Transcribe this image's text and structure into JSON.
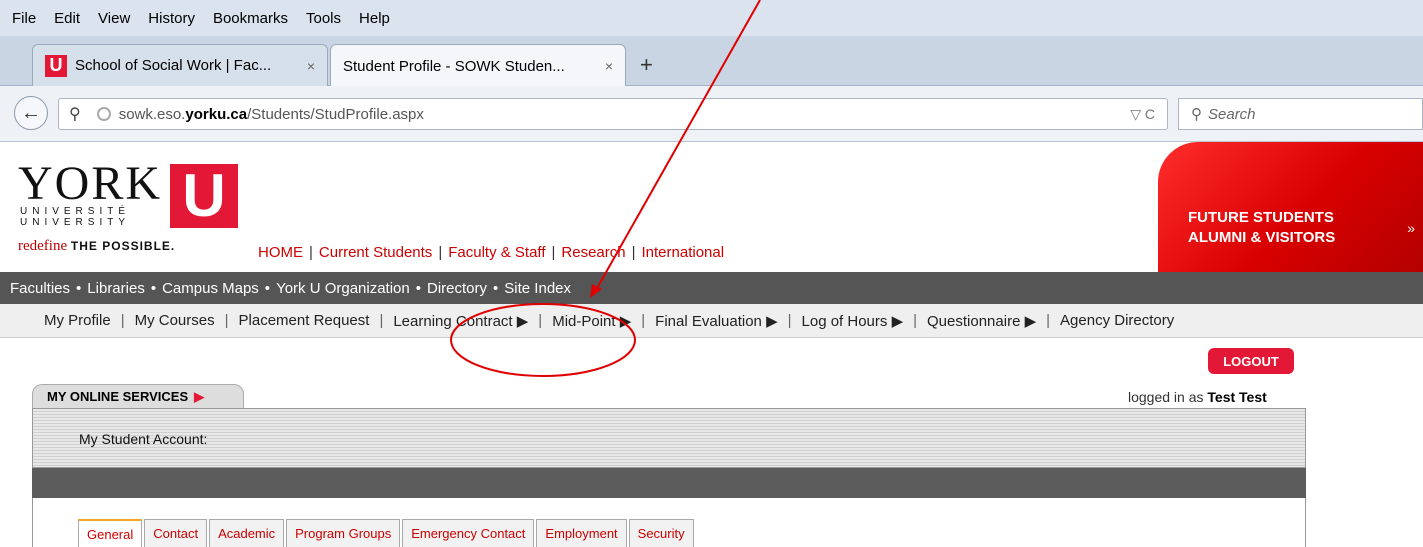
{
  "menubar": {
    "items": [
      "File",
      "Edit",
      "View",
      "History",
      "Bookmarks",
      "Tools",
      "Help"
    ],
    "access_keys": [
      "F",
      "E",
      "V",
      "s",
      "B",
      "T",
      "H"
    ]
  },
  "tabs": [
    {
      "label": "School of Social Work | Fac...",
      "close": "×"
    },
    {
      "label": "Student Profile - SOWK Studen...",
      "close": "×"
    }
  ],
  "newtab_label": "+",
  "url": {
    "prefix": "sowk.eso.",
    "domain": "yorku.ca",
    "path": "/Students/StudProfile.aspx",
    "right_icons": "▽ C"
  },
  "search": {
    "placeholder": "Search"
  },
  "header": {
    "logo_text": "YORK",
    "logo_u": "U",
    "logo_sub1": "UNIVERSITÉ",
    "logo_sub2": "UNIVERSITY",
    "tagline_script": "redefine",
    "tagline_bold": "THE POSSIBLE.",
    "links": [
      "HOME",
      "Current Students",
      "Faculty & Staff",
      "Research",
      "International"
    ],
    "future_line1": "FUTURE STUDENTS",
    "future_line2": "ALUMNI & VISITORS",
    "future_arrow": "»"
  },
  "darknav": [
    "Faculties",
    "Libraries",
    "Campus Maps",
    "York U Organization",
    "Directory",
    "Site Index"
  ],
  "subnav": [
    "My Profile",
    "My Courses",
    "Placement Request",
    "Learning Contract ▶",
    "Mid-Point ▶",
    "Final Evaluation ▶",
    "Log of Hours ▶",
    "Questionnaire ▶",
    "Agency Directory"
  ],
  "logout_label": "LOGOUT",
  "services": {
    "label": "MY ONLINE SERVICES",
    "arrow": "▶"
  },
  "loggedin": {
    "prefix": "logged in as ",
    "user": "Test Test"
  },
  "account_label": "My Student Account:",
  "profile_tabs": [
    "General",
    "Contact",
    "Academic",
    "Program Groups",
    "Emergency Contact",
    "Employment",
    "Security"
  ],
  "colors": {
    "york_red": "#e31837",
    "annotation": "#e00000"
  }
}
